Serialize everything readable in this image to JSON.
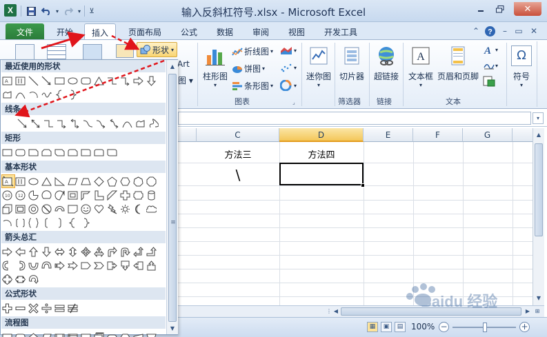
{
  "window": {
    "title": "输入反斜杠符号.xlsx - Microsoft Excel",
    "app_icon": "X"
  },
  "tabs": [
    "文件",
    "开始",
    "插入",
    "页面布局",
    "公式",
    "数据",
    "审阅",
    "视图",
    "开发工具"
  ],
  "active_tab": "插入",
  "ribbon": {
    "shapes_button": "形状",
    "art_label": "Art",
    "chart_buttons": {
      "column": "柱形图",
      "line": "折线图",
      "pie": "饼图",
      "bar": "条形图"
    },
    "group_chart": "图表",
    "sparkline": "迷你图",
    "slicer": "切片器",
    "group_filter": "筛选器",
    "hyperlink": "超链接",
    "group_links": "链接",
    "textbox": "文本框",
    "header_footer": "页眉和页脚",
    "group_text": "文本",
    "symbol": "符号",
    "symbol_glyph": "Ω"
  },
  "shapes_panel": {
    "categories": {
      "recent": "最近使用的形状",
      "lines": "线条",
      "rect": "矩形",
      "basic": "基本形状",
      "arrows": "箭头总汇",
      "equation": "公式形状",
      "flowchart": "流程图"
    },
    "scroll_grip": "≡"
  },
  "grid": {
    "columns": [
      "C",
      "D",
      "E",
      "F",
      "G"
    ],
    "selected_column": "D",
    "cells": {
      "c1": "方法三",
      "d1": "方法四",
      "c2": "\\"
    }
  },
  "statusbar": {
    "zoom": "100%"
  },
  "colors": {
    "file_tab": "#2a7b3a",
    "selected_col": "#f4c75a",
    "arrow_red": "#e0151b"
  },
  "watermark": "Baidu 经验"
}
